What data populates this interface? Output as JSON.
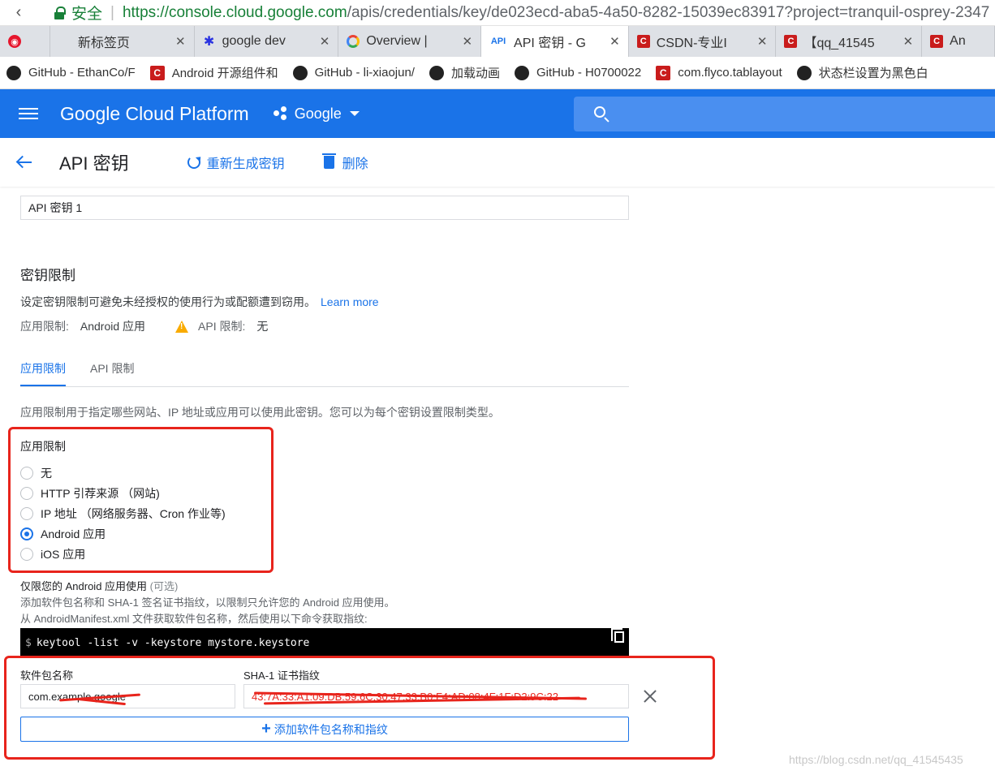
{
  "browser": {
    "secure_label": "安全",
    "url_host": "https://console.cloud.google.com",
    "url_path": "/apis/credentials/key/de023ecd-aba5-4a50-8282-15039ec83917?project=tranquil-osprey-2347",
    "tabs": [
      {
        "label": "",
        "icon": "weibo-icon"
      },
      {
        "label": "新标签页",
        "icon": ""
      },
      {
        "label": "google dev",
        "icon": "baidu-icon"
      },
      {
        "label": "Overview |",
        "icon": "google-cloud-icon"
      },
      {
        "label": "API 密钥 - G",
        "icon": "api-icon"
      },
      {
        "label": "CSDN-专业I",
        "icon": "csdn-icon"
      },
      {
        "label": "【qq_41545",
        "icon": "csdn-icon"
      },
      {
        "label": "An",
        "icon": "csdn-icon"
      }
    ],
    "bookmarks": [
      {
        "label": "GitHub - EthanCo/F",
        "icon": "github-icon"
      },
      {
        "label": "Android 开源组件和",
        "icon": "csdn-icon"
      },
      {
        "label": "GitHub - li-xiaojun/",
        "icon": "github-icon"
      },
      {
        "label": "加载动画",
        "icon": "github-icon"
      },
      {
        "label": "GitHub - H0700022",
        "icon": "github-icon"
      },
      {
        "label": "com.flyco.tablayout",
        "icon": "csdn-icon"
      },
      {
        "label": "状态栏设置为黑色白",
        "icon": "github-icon"
      }
    ]
  },
  "header": {
    "brand": "Google Cloud Platform",
    "project": "Google",
    "color": "#1a73e8"
  },
  "toolbar": {
    "title": "API 密钥",
    "regenerate": "重新生成密钥",
    "delete": "删除"
  },
  "form": {
    "name_value": "API 密钥 1",
    "restrictions_title": "密钥限制",
    "restrictions_desc": "设定密钥限制可避免未经授权的使用行为或配额遭到窃用。",
    "learn_more": "Learn more",
    "app_restr_label": "应用限制:",
    "app_restr_value": "Android 应用",
    "api_restr_label": "API 限制:",
    "api_restr_value": "无",
    "subtabs": [
      "应用限制",
      "API 限制"
    ],
    "tab_desc": "应用限制用于指定哪些网站、IP 地址或应用可以使用此密钥。您可以为每个密钥设置限制类型。",
    "radio_title": "应用限制",
    "radios": [
      {
        "label": "无",
        "checked": false
      },
      {
        "label": "HTTP 引荐来源 （网站)",
        "checked": false
      },
      {
        "label": "IP 地址 （网络服务器、Cron 作业等)",
        "checked": false
      },
      {
        "label": "Android 应用",
        "checked": true
      },
      {
        "label": "iOS 应用",
        "checked": false
      }
    ],
    "android_title": "仅限您的 Android 应用使用",
    "android_optional": "(可选)",
    "android_hint1": "添加软件包名称和 SHA-1 签名证书指纹，以限制只允许您的 Android 应用使用。",
    "android_hint2": "从 AndroidManifest.xml 文件获取软件包名称，然后使用以下命令获取指纹:",
    "code_prompt": "$",
    "code": "keytool -list -v -keystore mystore.keystore",
    "pkg_label": "软件包名称",
    "pkg_value": "com.example.google",
    "sha_label": "SHA-1 证书指纹",
    "sha_value": "43:7A:33:A1:09:DB:59:6C:30:47:33:B0:F4:AD:08:4F:1F:D2:9C:22",
    "add_button": "添加软件包名称和指纹"
  },
  "watermark": "https://blog.csdn.net/qq_41545435",
  "accent_color": "#1a73e8",
  "annotation_color": "#e8241c"
}
